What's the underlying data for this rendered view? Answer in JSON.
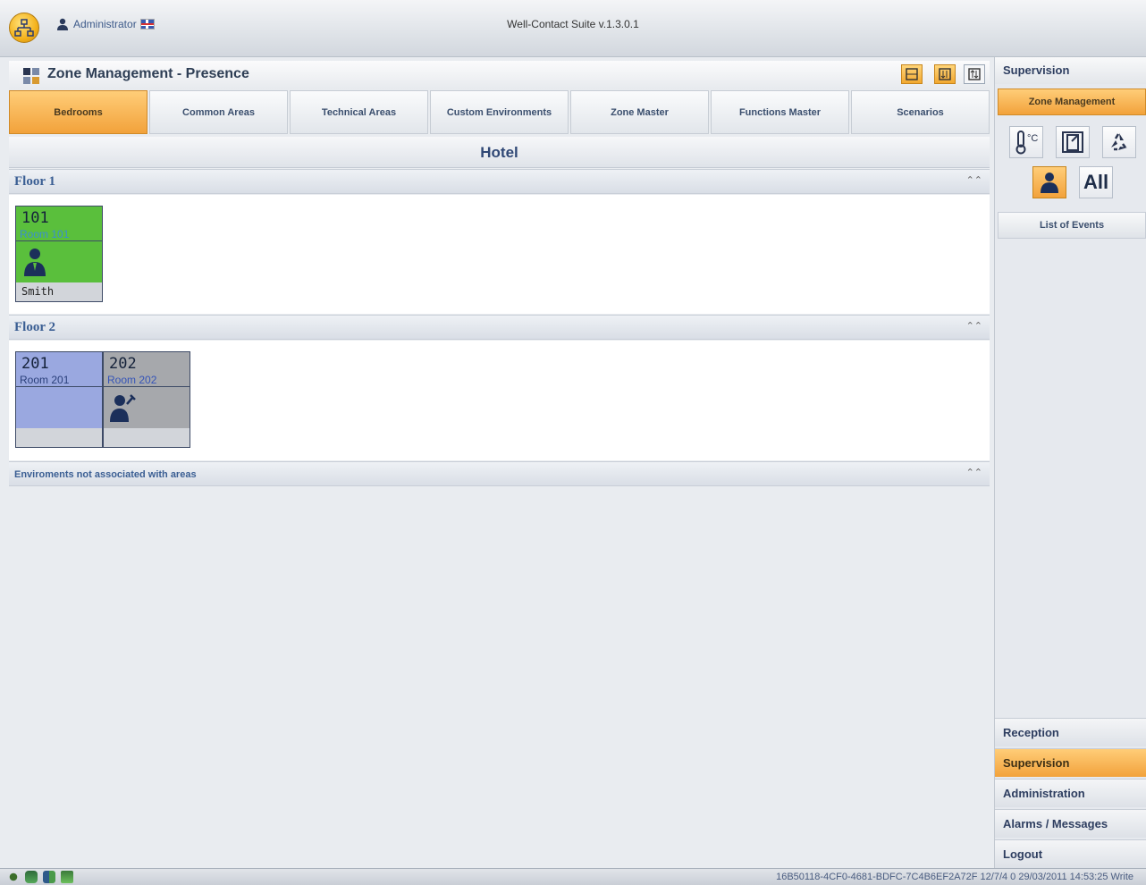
{
  "window": {
    "title": "Well-Contact Suite v.1.3.0.1",
    "user": "Administrator"
  },
  "header": {
    "title": "Zone Management - Presence"
  },
  "tabs": [
    {
      "label": "Bedrooms",
      "active": true
    },
    {
      "label": "Common Areas",
      "active": false
    },
    {
      "label": "Technical Areas",
      "active": false
    },
    {
      "label": "Custom Environments",
      "active": false
    },
    {
      "label": "Zone Master",
      "active": false
    },
    {
      "label": "Functions Master",
      "active": false
    },
    {
      "label": "Scenarios",
      "active": false
    }
  ],
  "main": {
    "building": "Hotel",
    "sections": [
      {
        "title": "Floor 1"
      },
      {
        "title": "Floor 2"
      },
      {
        "title": "Enviroments not associated with areas"
      }
    ],
    "rooms": [
      {
        "number": "101",
        "name": "Room 101",
        "guest": "Smith",
        "status": "occupied",
        "color": "#5abf3c"
      },
      {
        "number": "201",
        "name": "Room 201",
        "guest": "",
        "status": "empty",
        "color": "#9aa8e0"
      },
      {
        "number": "202",
        "name": "Room 202",
        "guest": "",
        "status": "service",
        "color": "#a6a8ac"
      }
    ]
  },
  "sidebar": {
    "header": "Supervision",
    "zone_label": "Zone Management",
    "all_label": "All",
    "events_label": "List of Events",
    "nav": [
      {
        "label": "Reception",
        "active": false
      },
      {
        "label": "Supervision",
        "active": true
      },
      {
        "label": "Administration",
        "active": false
      },
      {
        "label": "Alarms / Messages",
        "active": false
      },
      {
        "label": "Logout",
        "active": false
      }
    ]
  },
  "status": {
    "text": "16B50118-4CF0-4681-BDFC-7C4B6EF2A72F 12/7/4 0 29/03/2011 14:53:25 Write"
  },
  "colors": {
    "accent": "#f2a23b",
    "occupied": "#5abf3c",
    "empty": "#9aa8e0",
    "service": "#a6a8ac"
  }
}
